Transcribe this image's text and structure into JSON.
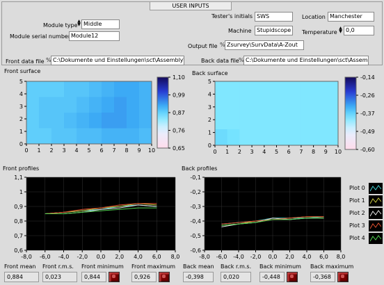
{
  "header": {
    "title": "USER INPUTS"
  },
  "inputs": {
    "module_type": {
      "label": "Module type",
      "value": "Middle"
    },
    "module_serial": {
      "label": "Module serial number",
      "value": "Module12"
    },
    "tester": {
      "label": "Tester's initials",
      "value": "SWS"
    },
    "location": {
      "label": "Location",
      "value": "Manchester"
    },
    "machine": {
      "label": "Machine",
      "value": "Stupidscope"
    },
    "temperature": {
      "label": "Temperature",
      "value": "0,0"
    },
    "output_file": {
      "label": "Output file",
      "value": "Zsurvey\\SurvData\\A-Zout"
    },
    "front_data_file": {
      "label": "Front data file",
      "value": "C:\\Dokumente und Einstellungen\\sct\\Assembly\\"
    },
    "back_data_file": {
      "label": "Back data file",
      "value": "C:\\Dokumente und Einstellungen\\sct\\Assembly\\"
    }
  },
  "surfaces": {
    "front": {
      "title": "Front surface",
      "scale_ticks": [
        "1,10",
        "0,99",
        "0,87",
        "0,76",
        "0,65"
      ],
      "scale_range": [
        0.65,
        1.1
      ]
    },
    "back": {
      "title": "Back surface",
      "scale_ticks": [
        "-0,14",
        "-0,26",
        "-0,37",
        "-0,49",
        "-0,60"
      ],
      "scale_range": [
        -0.6,
        -0.14
      ]
    }
  },
  "profiles": {
    "front": {
      "title": "Front profiles"
    },
    "back": {
      "title": "Back profiles"
    },
    "legend": [
      "Plot 0",
      "Plot 1",
      "Plot 2",
      "Plot 3",
      "Plot 4"
    ],
    "legend_colors": [
      "#40d0d0",
      "#c8c840",
      "#e8e8e8",
      "#e05030",
      "#50d050"
    ]
  },
  "chart_data": [
    {
      "type": "heatmap",
      "title": "Front surface",
      "x_ticks": [
        "0",
        "1",
        "2",
        "3",
        "4",
        "5",
        "6",
        "7",
        "8",
        "9",
        "10"
      ],
      "y_ticks": [
        "0",
        "1",
        "2",
        "3",
        "4",
        "5"
      ],
      "xlim": [
        0,
        10
      ],
      "ylim": [
        0,
        5
      ],
      "colorbar_range": [
        0.65,
        1.1
      ],
      "grid": [
        [
          0.88,
          0.88,
          0.88,
          0.89,
          0.89,
          0.9,
          0.91,
          0.92,
          0.92,
          0.91
        ],
        [
          0.88,
          0.89,
          0.89,
          0.89,
          0.9,
          0.91,
          0.92,
          0.93,
          0.92,
          0.91
        ],
        [
          0.88,
          0.89,
          0.89,
          0.9,
          0.91,
          0.92,
          0.93,
          0.93,
          0.92,
          0.91
        ],
        [
          0.88,
          0.88,
          0.89,
          0.89,
          0.9,
          0.9,
          0.91,
          0.91,
          0.91,
          0.9
        ]
      ]
    },
    {
      "type": "heatmap",
      "title": "Back surface",
      "x_ticks": [
        "0",
        "1",
        "2",
        "3",
        "4",
        "5",
        "6",
        "7",
        "8",
        "9",
        "10"
      ],
      "y_ticks": [
        "0",
        "1",
        "2",
        "3",
        "4",
        "5"
      ],
      "xlim": [
        0,
        10
      ],
      "ylim": [
        0,
        5
      ],
      "colorbar_range": [
        -0.6,
        -0.14
      ],
      "grid": [
        [
          -0.4,
          -0.4,
          -0.4,
          -0.4,
          -0.4,
          -0.4,
          -0.4,
          -0.4,
          -0.4,
          -0.4
        ],
        [
          -0.4,
          -0.4,
          -0.4,
          -0.4,
          -0.4,
          -0.4,
          -0.4,
          -0.4,
          -0.4,
          -0.4
        ],
        [
          -0.4,
          -0.4,
          -0.4,
          -0.4,
          -0.4,
          -0.4,
          -0.4,
          -0.4,
          -0.4,
          -0.4
        ],
        [
          -0.38,
          -0.39,
          -0.4,
          -0.4,
          -0.4,
          -0.4,
          -0.4,
          -0.4,
          -0.4,
          -0.4
        ]
      ]
    },
    {
      "type": "line",
      "title": "Front profiles",
      "x_ticks": [
        "-8,0",
        "-6,0",
        "-4,0",
        "-2,0",
        "0,0",
        "2,0",
        "4,0",
        "6,0",
        "8,0"
      ],
      "y_ticks": [
        "0,6",
        "0,7",
        "0,8",
        "0,9",
        "1",
        "1,1"
      ],
      "xlim": [
        -8,
        8
      ],
      "ylim": [
        0.6,
        1.1
      ],
      "series": [
        {
          "name": "Plot 0",
          "x": [
            -6,
            -4,
            -2,
            0,
            2,
            4,
            6
          ],
          "y": [
            0.85,
            0.86,
            0.87,
            0.88,
            0.9,
            0.91,
            0.9
          ]
        },
        {
          "name": "Plot 1",
          "x": [
            -6,
            -4,
            -2,
            0,
            2,
            4,
            6
          ],
          "y": [
            0.85,
            0.86,
            0.87,
            0.89,
            0.9,
            0.92,
            0.91
          ]
        },
        {
          "name": "Plot 2",
          "x": [
            -6,
            -4,
            -2,
            0,
            2,
            4,
            6
          ],
          "y": [
            0.85,
            0.85,
            0.86,
            0.88,
            0.89,
            0.91,
            0.9
          ]
        },
        {
          "name": "Plot 3",
          "x": [
            -6,
            -4,
            -2,
            0,
            2,
            4,
            6
          ],
          "y": [
            0.85,
            0.86,
            0.88,
            0.89,
            0.91,
            0.92,
            0.92
          ]
        },
        {
          "name": "Plot 4",
          "x": [
            -6,
            -4,
            -2,
            0,
            2,
            4,
            6
          ],
          "y": [
            0.85,
            0.85,
            0.86,
            0.87,
            0.88,
            0.89,
            0.89
          ]
        }
      ]
    },
    {
      "type": "line",
      "title": "Back profiles",
      "x_ticks": [
        "-8,0",
        "-6,0",
        "-4,0",
        "-2,0",
        "0,0",
        "2,0",
        "4,0",
        "6,0",
        "8,0"
      ],
      "y_ticks": [
        "-0,1",
        "-0,2",
        "-0,3",
        "-0,4",
        "-0,5",
        "-0,6"
      ],
      "xlim": [
        -8,
        8
      ],
      "ylim": [
        -0.6,
        -0.1
      ],
      "series": [
        {
          "name": "Plot 0",
          "x": [
            -6,
            -4,
            -2,
            0,
            2,
            4,
            6
          ],
          "y": [
            -0.42,
            -0.41,
            -0.4,
            -0.38,
            -0.38,
            -0.38,
            -0.37
          ]
        },
        {
          "name": "Plot 1",
          "x": [
            -6,
            -4,
            -2,
            0,
            2,
            4,
            6
          ],
          "y": [
            -0.43,
            -0.42,
            -0.4,
            -0.39,
            -0.38,
            -0.37,
            -0.37
          ]
        },
        {
          "name": "Plot 2",
          "x": [
            -6,
            -4,
            -2,
            0,
            2,
            4,
            6
          ],
          "y": [
            -0.44,
            -0.42,
            -0.41,
            -0.38,
            -0.39,
            -0.38,
            -0.38
          ]
        },
        {
          "name": "Plot 3",
          "x": [
            -6,
            -4,
            -2,
            0,
            2,
            4,
            6
          ],
          "y": [
            -0.42,
            -0.41,
            -0.4,
            -0.39,
            -0.38,
            -0.37,
            -0.37
          ]
        },
        {
          "name": "Plot 4",
          "x": [
            -6,
            -4,
            -2,
            0,
            2,
            4,
            6
          ],
          "y": [
            -0.43,
            -0.42,
            -0.41,
            -0.39,
            -0.39,
            -0.38,
            -0.38
          ]
        }
      ]
    }
  ],
  "stats": {
    "front_mean": {
      "label": "Front mean",
      "value": "0,884"
    },
    "front_rms": {
      "label": "Front r.m.s.",
      "value": "0,023"
    },
    "front_min": {
      "label": "Front minimum",
      "value": "0,844"
    },
    "front_max": {
      "label": "Front maximum",
      "value": "0,926"
    },
    "back_mean": {
      "label": "Back mean",
      "value": "-0,398"
    },
    "back_rms": {
      "label": "Back r.m.s.",
      "value": "0,020"
    },
    "back_min": {
      "label": "Back minimum",
      "value": "-0,448"
    },
    "back_max": {
      "label": "Back maximum",
      "value": "-0,368"
    }
  }
}
